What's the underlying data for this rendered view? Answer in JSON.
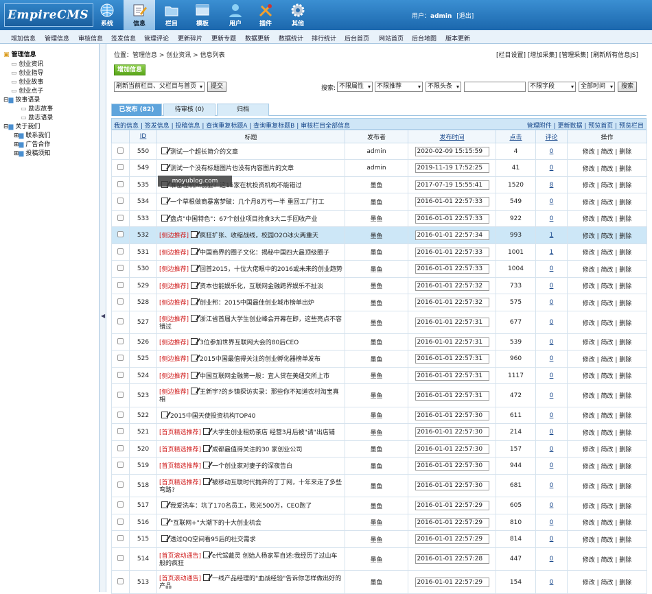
{
  "app": {
    "logo": "EmpireCMS",
    "user_label": "用户：",
    "user_name": "admin",
    "logout": "[退出]"
  },
  "main_nav": [
    {
      "label": "系统",
      "icon": "globe-icon"
    },
    {
      "label": "信息",
      "icon": "edit-icon"
    },
    {
      "label": "栏目",
      "icon": "folder-icon"
    },
    {
      "label": "模板",
      "icon": "window-icon"
    },
    {
      "label": "用户",
      "icon": "user-icon"
    },
    {
      "label": "插件",
      "icon": "tools-icon"
    },
    {
      "label": "其他",
      "icon": "gear-icon"
    }
  ],
  "sub_nav": [
    "增加信息",
    "管理信息",
    "审核信息",
    "签发信息",
    "管理评论",
    "更新碎片",
    "更新专题",
    "数据更新",
    "数据统计",
    "排行统计",
    "后台首页",
    "网站首页",
    "后台地图",
    "版本更新"
  ],
  "sidebar": {
    "root": "管理信息",
    "items": [
      "创业资讯",
      "创业指导",
      "创业故事",
      "创业点子",
      "故事语录",
      "励志故事",
      "励志语录",
      "关于我们",
      "联系我们",
      "广告合作",
      "投稿须知"
    ]
  },
  "crumb": {
    "label": "位置：",
    "a": "管理信息",
    "b": "创业资讯",
    "c": "信息列表"
  },
  "top_links": "[栏目设置] [增加采集] [管理采集] [刷新所有信息JS]",
  "toolbar": {
    "add": "增加信息",
    "refresh_select": "刷新当前栏目、父栏目与首页",
    "submit": "提交",
    "search_label": "搜索:",
    "attr": "不限属性",
    "rec": "不限推荐",
    "head": "不限头条",
    "field": "不限字段",
    "time": "全部时间",
    "search_btn": "搜索"
  },
  "tabs": [
    "已发布 (82)",
    "待审核 (0)",
    "归档"
  ],
  "actions_left": "我的信息 | 签发信息 | 投稿信息 | 查询重复标题A | 查询重复标题B | 审核栏目全部信息",
  "actions_right": "管理附件 | 更新数据 | 预览首页 | 预览栏目",
  "columns": [
    "ID",
    "标题",
    "发布者",
    "发布时间",
    "点击",
    "评论",
    "操作"
  ],
  "ops": "修改 | 简改 | 删除",
  "watermark": "moyublog.com",
  "rows": [
    {
      "id": "550",
      "tag": "",
      "title": "测试一个超长简介的文章",
      "author": "admin",
      "time": "2020-02-09 15:15:59",
      "hits": "4",
      "comments": "0",
      "h": 24
    },
    {
      "id": "549",
      "tag": "",
      "title": "测试一个没有标题图片也没有内容图片的文章",
      "author": "admin",
      "time": "2019-11-19 17:52:25",
      "hits": "41",
      "comments": "0",
      "h": 25
    },
    {
      "id": "535",
      "tag": "",
      "title": "准备在杭州创业？这15家在杭投资机构不能错过",
      "author": "墨鱼",
      "time": "2017-07-19 15:55:41",
      "hits": "1520",
      "comments": "8",
      "h": 24
    },
    {
      "id": "534",
      "tag": "",
      "title": "一个草根做商暴富梦破：几个月8万亏一半 重回工厂打工",
      "author": "墨鱼",
      "time": "2016-01-01 22:57:33",
      "hits": "549",
      "comments": "0",
      "h": 25
    },
    {
      "id": "533",
      "tag": "",
      "title": "盘点\"中国特色\"：67个创业项目抢食3大二手回收产业",
      "author": "墨鱼",
      "time": "2016-01-01 22:57:33",
      "hits": "922",
      "comments": "0",
      "h": 24
    },
    {
      "id": "532",
      "tag": "[侧边推荐]",
      "title": "疯狂扩张、收缩战线，校园O2O冰火两重天",
      "author": "墨鱼",
      "time": "2016-01-01 22:57:34",
      "hits": "993",
      "comments": "1",
      "h": 25,
      "hl": true
    },
    {
      "id": "531",
      "tag": "[侧边推荐]",
      "title": "中国商界的圈子文化：揭秘中国四大最顶级圈子",
      "author": "墨鱼",
      "time": "2016-01-01 22:57:33",
      "hits": "1001",
      "comments": "1",
      "h": 24
    },
    {
      "id": "530",
      "tag": "[侧边推荐]",
      "title": "回首2015，十位大佬眼中的2016或未来的创业趋势",
      "author": "墨鱼",
      "time": "2016-01-01 22:57:33",
      "hits": "1004",
      "comments": "0",
      "h": 25
    },
    {
      "id": "529",
      "tag": "[侧边推荐]",
      "title": "资本也能娱乐化，互联网金融跨界娱乐不扯淡",
      "author": "墨鱼",
      "time": "2016-01-01 22:57:32",
      "hits": "733",
      "comments": "0",
      "h": 24
    },
    {
      "id": "528",
      "tag": "[侧边推荐]",
      "title": "创业邦：2015中国最佳创业城市榜单出炉",
      "author": "墨鱼",
      "time": "2016-01-01 22:57:32",
      "hits": "575",
      "comments": "0",
      "h": 25
    },
    {
      "id": "527",
      "tag": "[侧边推荐]",
      "title": "浙江省首届大学生创业峰会开幕在即，这些亮点不容错过",
      "author": "墨鱼",
      "time": "2016-01-01 22:57:31",
      "hits": "677",
      "comments": "0",
      "h": 33
    },
    {
      "id": "526",
      "tag": "[侧边推荐]",
      "title": "3位参加世界互联网大会的80后CEO",
      "author": "墨鱼",
      "time": "2016-01-01 22:57:31",
      "hits": "539",
      "comments": "0",
      "h": 24
    },
    {
      "id": "525",
      "tag": "[侧边推荐]",
      "title": "2015中国最值得关注的创业孵化器榜单发布",
      "author": "墨鱼",
      "time": "2016-01-01 22:57:31",
      "hits": "960",
      "comments": "0",
      "h": 25
    },
    {
      "id": "524",
      "tag": "[侧边推荐]",
      "title": "中国互联网金融第一股：宜人贷在美纽交所上市",
      "author": "墨鱼",
      "time": "2016-01-01 22:57:31",
      "hits": "1117",
      "comments": "0",
      "h": 24
    },
    {
      "id": "523",
      "tag": "[侧边推荐]",
      "title": "王新宇?的乡镇探访实录：那些你不知道农村淘宝真相",
      "author": "墨鱼",
      "time": "2016-01-01 22:57:31",
      "hits": "472",
      "comments": "0",
      "h": 34
    },
    {
      "id": "522",
      "tag": "",
      "title": "2015中国天使投资机构TOP40",
      "author": "墨鱼",
      "time": "2016-01-01 22:57:30",
      "hits": "611",
      "comments": "0",
      "h": 24
    },
    {
      "id": "521",
      "tag": "[首页精选推荐]",
      "title": "大学生创业租奶茶店 经营3月后被\"请\"出店铺",
      "author": "墨鱼",
      "time": "2016-01-01 22:57:30",
      "hits": "214",
      "comments": "0",
      "h": 25
    },
    {
      "id": "520",
      "tag": "[首页精选推荐]",
      "title": "成都最值得关注的30 家创业公司",
      "author": "墨鱼",
      "time": "2016-01-01 22:57:30",
      "hits": "157",
      "comments": "0",
      "h": 24
    },
    {
      "id": "519",
      "tag": "[首页精选推荐]",
      "title": "一个创业家对妻子的深夜告白",
      "author": "墨鱼",
      "time": "2016-01-01 22:57:30",
      "hits": "944",
      "comments": "0",
      "h": 25
    },
    {
      "id": "518",
      "tag": "[首页精选推荐]",
      "title": "被移动互联时代抛弃的丁丁网，十年来走了多些弯路?",
      "author": "墨鱼",
      "time": "2016-01-01 22:57:30",
      "hits": "681",
      "comments": "0",
      "h": 33
    },
    {
      "id": "517",
      "tag": "",
      "title": "我爱洗车：坑了170名员工，败光500万，CEO跑了",
      "author": "墨鱼",
      "time": "2016-01-01 22:57:29",
      "hits": "605",
      "comments": "0",
      "h": 25
    },
    {
      "id": "516",
      "tag": "",
      "title": "\"互联网+\"大潮下的十大创业机会",
      "author": "墨鱼",
      "time": "2016-01-01 22:57:29",
      "hits": "810",
      "comments": "0",
      "h": 24
    },
    {
      "id": "515",
      "tag": "",
      "title": "透过QQ空间看95后的社交需求",
      "author": "墨鱼",
      "time": "2016-01-01 22:57:29",
      "hits": "814",
      "comments": "0",
      "h": 25
    },
    {
      "id": "514",
      "tag": "[首页滚动通告]",
      "title": "e代驾戴灵 创始人杨家军自述:我经历了过山车般的疯狂",
      "author": "墨鱼",
      "time": "2016-01-01 22:57:28",
      "hits": "447",
      "comments": "0",
      "h": 33
    },
    {
      "id": "513",
      "tag": "[首页滚动通告]",
      "title": "一线产品经理的\"血战经验\"告诉你怎样做出好的产品",
      "author": "墨鱼",
      "time": "2016-01-01 22:57:29",
      "hits": "154",
      "comments": "0",
      "h": 34
    }
  ]
}
